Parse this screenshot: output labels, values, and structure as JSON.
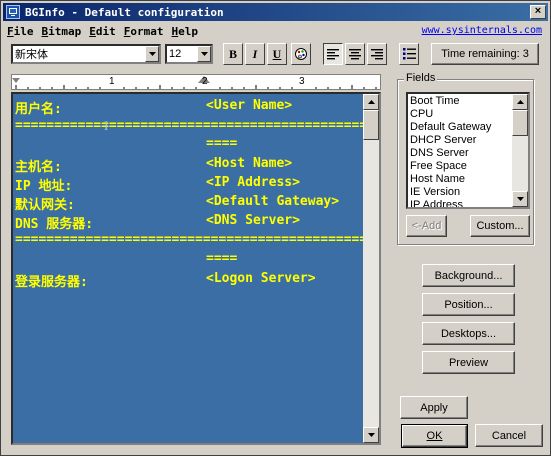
{
  "window": {
    "title": "BGInfo - Default configuration",
    "close_glyph": "×"
  },
  "menu": {
    "items": [
      {
        "label": "File",
        "accel": "F",
        "rest": "ile"
      },
      {
        "label": "Bitmap",
        "accel": "B",
        "rest": "itmap"
      },
      {
        "label": "Edit",
        "accel": "E",
        "rest": "dit"
      },
      {
        "label": "Format",
        "accel": "F",
        "rest": "ormat"
      },
      {
        "label": "Help",
        "accel": "H",
        "rest": "elp"
      }
    ],
    "link": "www.sysinternals.com"
  },
  "toolbar": {
    "font_name": "新宋体",
    "font_size": "12",
    "bold": "B",
    "italic": "I",
    "underline": "U",
    "timer_label": "Time remaining: 3"
  },
  "ruler": {
    "marks": [
      "1",
      "2",
      "3"
    ]
  },
  "editor": {
    "background": "#3a6ea5",
    "text_color": "#ffff00",
    "lines": [
      {
        "label": "用户名:",
        "value": "<User Name>"
      },
      {
        "separator": "=============================================",
        "tail": "===="
      },
      {
        "label": "主机名:",
        "value": "<Host Name>"
      },
      {
        "label": "IP 地址:",
        "value": "<IP Address>"
      },
      {
        "label": "默认网关:",
        "value": "<Default Gateway>"
      },
      {
        "label": "DNS 服务器:",
        "value": "<DNS Server>"
      },
      {
        "separator": "=============================================",
        "tail": "===="
      },
      {
        "label": "登录服务器:",
        "value": "<Logon Server>"
      }
    ]
  },
  "fields": {
    "legend": "Fields",
    "items": [
      "Boot Time",
      "CPU",
      "Default Gateway",
      "DHCP Server",
      "DNS Server",
      "Free Space",
      "Host Name",
      "IE Version",
      "IP Address"
    ],
    "add_label": "<-Add",
    "custom_label": "Custom..."
  },
  "buttons": {
    "background": "Background...",
    "position": "Position...",
    "desktops": "Desktops...",
    "preview": "Preview",
    "apply": "Apply",
    "ok": "OK",
    "cancel": "Cancel"
  }
}
